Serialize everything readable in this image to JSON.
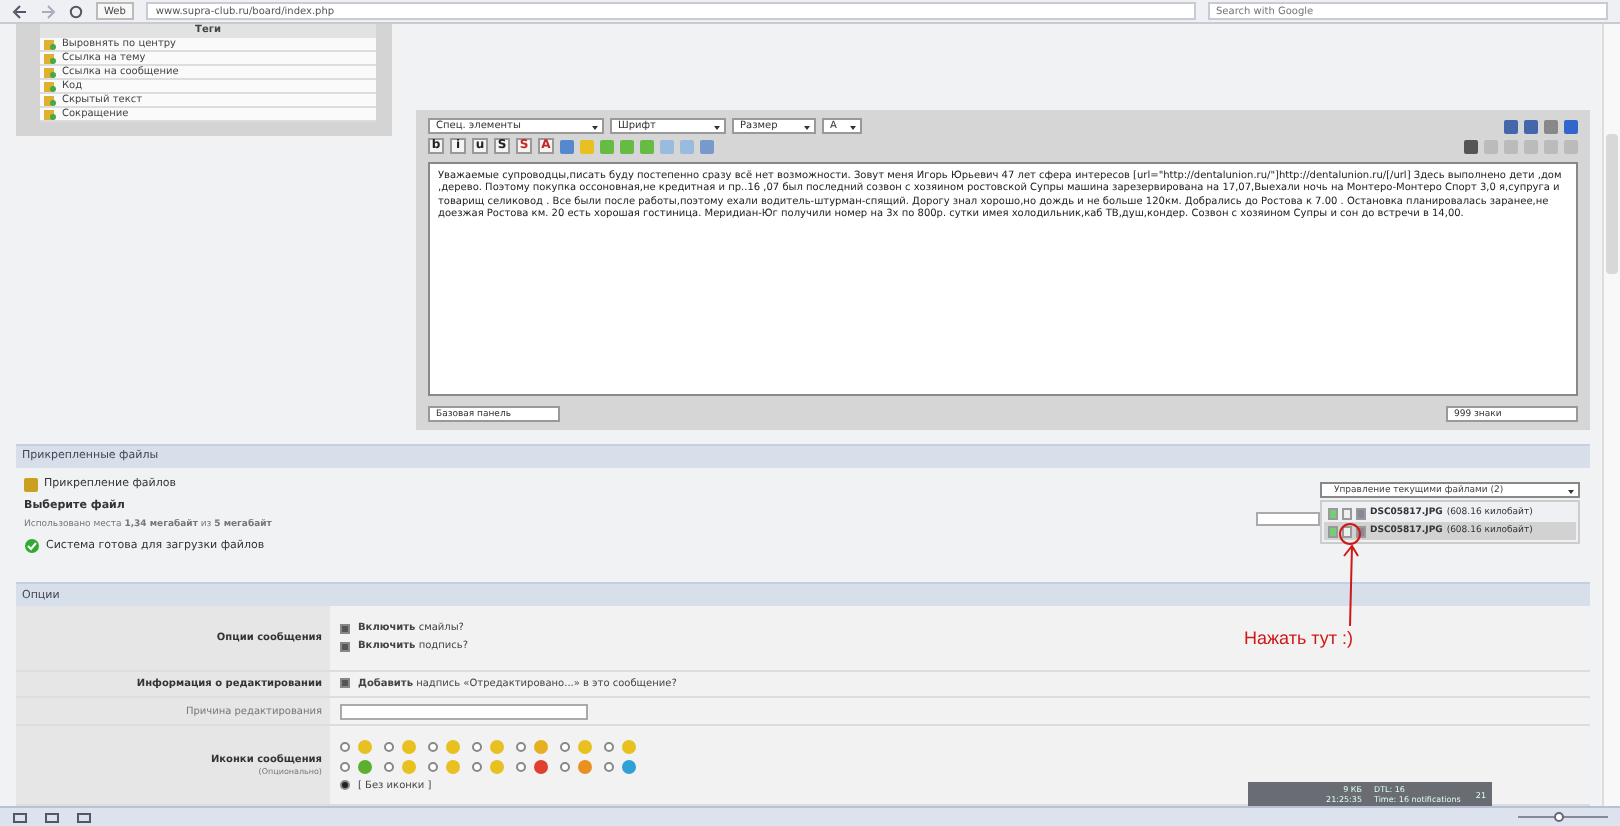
{
  "browser": {
    "web_label": "Web",
    "url": "www.supra-club.ru/board/index.php",
    "search_placeholder": "Search with Google"
  },
  "tags": {
    "title": "Теги",
    "items": [
      "Выровнять по центру",
      "Ссылка на тему",
      "Ссылка на сообщение",
      "Код",
      "Скрытый текст",
      "Сокращение"
    ]
  },
  "editor": {
    "selects": [
      "Спец. элементы",
      "Шрифт",
      "Размер",
      "A"
    ],
    "format_buttons": [
      "b",
      "i",
      "u",
      "S",
      "S",
      "A"
    ],
    "message": "Уважаемые супроводцы,писать буду постепенно сразу всё нет возможности. Зовут меня Игорь Юрьевич 47 лет сфера интересов [url=\"http://dentalunion.ru/\"]http://dentalunion.ru/[/url]  Здесь выполнено дети ,дом ,дерево. Поэтому покупка оссоновная,не кредитная и пр..16 ,07 был последний созвон с хозяином ростовской Супры машина зарезервирована на 17,07,Выехали ночь на Монтеро-Монтеро Спорт 3,0 я,супруга и товарищ селиковод . Все были после работы,поэтому ехали  водитель-штурман-спящий. Дорогу знал хорошо,но дождь и не больше 120км. Добрались до Ростова к 7.00 . Остановка планировалась заранее,не доезжая Ростова км. 20 есть хорошая гостиница. Меридиан-Юг получили номер на 3х по 800р. сутки имея холодильник,каб ТВ,душ,кондер. Созвон с хозяином Супры и сон до встречи в 14,00.",
    "bottom_left": "Базовая панель",
    "bottom_right": "999 знаки"
  },
  "attachments": {
    "title": "Прикрепленные файлы",
    "heading": "Прикрепление файлов",
    "choose": "Выберите файл",
    "usage": "Использовано места **1,34 мегабайт** из **5 мегабайт**",
    "status": "Система готова для загрузки файлов",
    "manager": "Управление текущими файлами (2)",
    "files": [
      {
        "name": "DSC05817.JPG",
        "size": "(608.16 килобайт)",
        "selected": false
      },
      {
        "name": "DSC05817.JPG",
        "size": "(608.16 килобайт)",
        "selected": true
      }
    ]
  },
  "annotation": "Нажать тут :)",
  "options": {
    "title": "Опции",
    "message_options": {
      "label": "Опции сообщения",
      "checks": [
        {
          "text": "**Включить** смайлы?",
          "checked": true
        },
        {
          "text": "**Включить** подпись?",
          "checked": true
        }
      ]
    },
    "edit_info": {
      "label": "Информация о редактировании",
      "checks": [
        {
          "text": "**Добавить** надпись «Отредактировано...» в это сообщение?",
          "checked": true
        }
      ]
    },
    "reason": {
      "label": "Причина редактирования"
    },
    "icons": {
      "label": "Иконки сообщения",
      "hint": "(Опционально)",
      "items": [
        {
          "color": "#e8c020",
          "selected": false
        },
        {
          "color": "#e8c020",
          "selected": false
        },
        {
          "color": "#e8c020",
          "selected": false
        },
        {
          "color": "#e8c020",
          "selected": false
        },
        {
          "color": "#e8b020",
          "selected": false
        },
        {
          "color": "#e8c020",
          "selected": false
        },
        {
          "color": "#e8c020",
          "selected": false
        },
        {
          "color": "#5cb030",
          "selected": false
        },
        {
          "color": "#e8c020",
          "selected": false
        },
        {
          "color": "#e8c020",
          "selected": false
        },
        {
          "color": "#e8c020",
          "selected": false
        },
        {
          "color": "#e04030",
          "selected": false
        },
        {
          "color": "#e89020",
          "selected": false
        },
        {
          "color": "#30a0d8",
          "selected": false
        }
      ],
      "none": {
        "label": "[ Без иконки ]",
        "selected": true
      }
    }
  },
  "widget": {
    "texts": [
      "9 КБ",
      "21:25:35",
      "DTL: 16",
      "Time: 16 notifications",
      "21"
    ]
  },
  "zoom": {
    "level": 0.45
  }
}
